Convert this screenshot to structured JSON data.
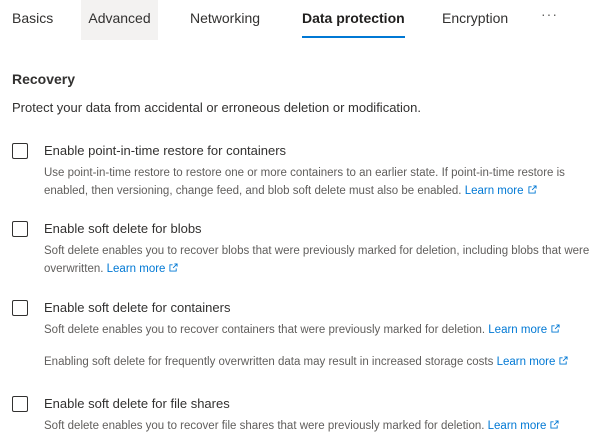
{
  "tabs": [
    {
      "label": "Basics"
    },
    {
      "label": "Advanced"
    },
    {
      "label": "Networking"
    },
    {
      "label": "Data protection"
    },
    {
      "label": "Encryption"
    },
    {
      "label": "···"
    }
  ],
  "recovery": {
    "title": "Recovery",
    "description": "Protect your data from accidental or erroneous deletion or modification.",
    "options": [
      {
        "label": "Enable point-in-time restore for containers",
        "help_text": "Use point-in-time restore to restore one or more containers to an earlier state. If point-in-time restore is enabled, then versioning, change feed, and blob soft delete must also be enabled.",
        "link": "Learn more",
        "checked": false
      },
      {
        "label": "Enable soft delete for blobs",
        "help_text": "Soft delete enables you to recover blobs that were previously marked for deletion, including blobs that were overwritten.",
        "link": "Learn more",
        "checked": false
      },
      {
        "label": "Enable soft delete for containers",
        "help_text": "Soft delete enables you to recover containers that were previously marked for deletion.",
        "link": "Learn more",
        "note_text": "Enabling soft delete for frequently overwritten data may result in increased storage costs",
        "note_link": "Learn more",
        "checked": false
      },
      {
        "label": "Enable soft delete for file shares",
        "help_text": "Soft delete enables you to recover file shares that were previously marked for deletion.",
        "link": "Learn more",
        "checked": false
      }
    ]
  },
  "colors": {
    "accent": "#0078d4",
    "text": "#323130",
    "muted_text": "#605e5c",
    "tab_hover_bg": "#f3f2f1"
  },
  "icons": {
    "external_link": "external-link-icon",
    "more": "more-tabs-icon"
  }
}
